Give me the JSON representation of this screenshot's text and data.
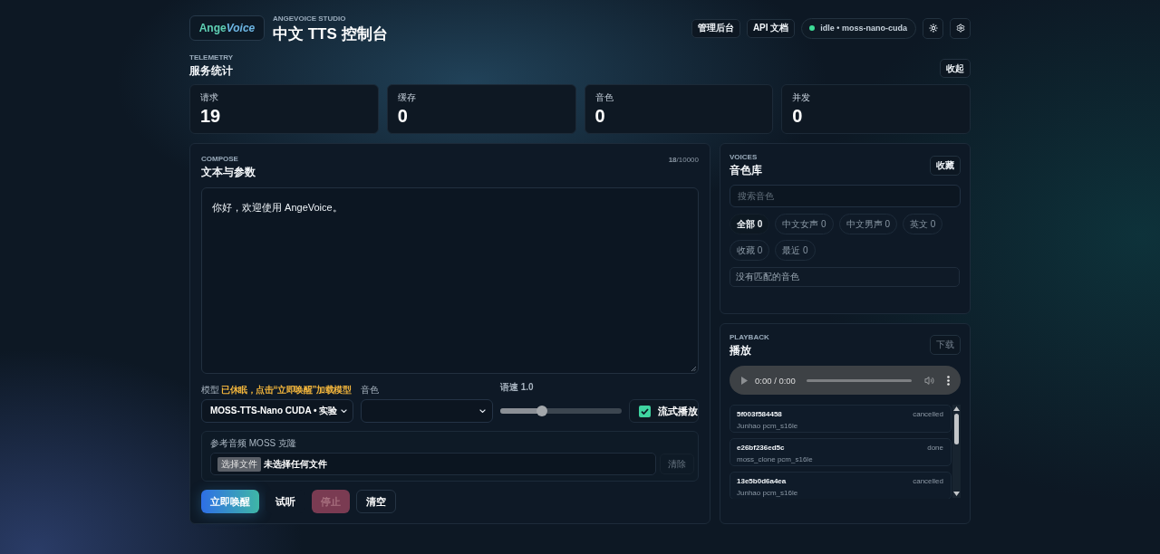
{
  "header": {
    "logo": {
      "text": "Ange",
      "accent": "Voice"
    },
    "eyebrow": "ANGEVOICE STUDIO",
    "title": "中文 TTS 控制台",
    "links": [
      {
        "label": "管理后台"
      },
      {
        "label": "API 文档"
      }
    ],
    "status": "idle • moss-nano-cuda"
  },
  "telemetry": {
    "eyebrow": "TELEMETRY",
    "title": "服务统计",
    "toggle": "收起",
    "stats": [
      {
        "label": "请求",
        "value": "19"
      },
      {
        "label": "缓存",
        "value": "0"
      },
      {
        "label": "音色",
        "value": "0"
      },
      {
        "label": "并发",
        "value": "0"
      }
    ]
  },
  "compose": {
    "eyebrow": "COMPOSE",
    "title": "文本与参数",
    "counter": "**18**/10000",
    "text": "你好，欢迎使用 AngeVoice。",
    "model": {
      "label": "模型",
      "status": "已休眠，点击“立即唤醒”加载模型",
      "value": "MOSS-TTS-Nano CUDA • 实验"
    },
    "voice": {
      "label": "音色"
    },
    "speed": {
      "label": "语速 1.0",
      "level": 0.34
    },
    "stream": {
      "label": "流式播放",
      "checked": true
    },
    "reference": {
      "label": "参考音频 MOSS 克隆",
      "file_button": "选择文件",
      "file_status": "未选择任何文件",
      "clear": {
        "label": "清除",
        "disabled": true
      }
    },
    "actions": [
      {
        "label": "立即唤醒",
        "kind": "primary",
        "disabled": false
      },
      {
        "label": "试听",
        "kind": "ghost",
        "disabled": false
      },
      {
        "label": "停止",
        "kind": "danger",
        "disabled": true
      },
      {
        "label": "清空",
        "kind": "outline",
        "disabled": false
      }
    ]
  },
  "voices": {
    "eyebrow": "VOICES",
    "title": "音色库",
    "favorite": "收藏",
    "search": {
      "placeholder": "搜索音色"
    },
    "filters": [
      {
        "label": "全部 0",
        "selected": true
      },
      {
        "label": "中文女声 0",
        "selected": false
      },
      {
        "label": "中文男声 0",
        "selected": false
      },
      {
        "label": "英文 0",
        "selected": false
      },
      {
        "label": "收藏 0",
        "selected": false
      },
      {
        "label": "最近 0",
        "selected": false
      }
    ],
    "empty": "没有匹配的音色"
  },
  "playback": {
    "eyebrow": "PLAYBACK",
    "title": "播放",
    "download": {
      "label": "下载",
      "disabled": true
    },
    "player": {
      "time": "0:00 / 0:00"
    },
    "jobs": [
      {
        "id": "5f003f584458",
        "meta": "Junhao pcm_s16le",
        "status": "cancelled"
      },
      {
        "id": "e26bf236ed5c",
        "meta": "moss_clone pcm_s16le",
        "status": "done"
      },
      {
        "id": "13e5b0d6a4ea",
        "meta": "Junhao pcm_s16le",
        "status": "cancelled"
      }
    ]
  }
}
